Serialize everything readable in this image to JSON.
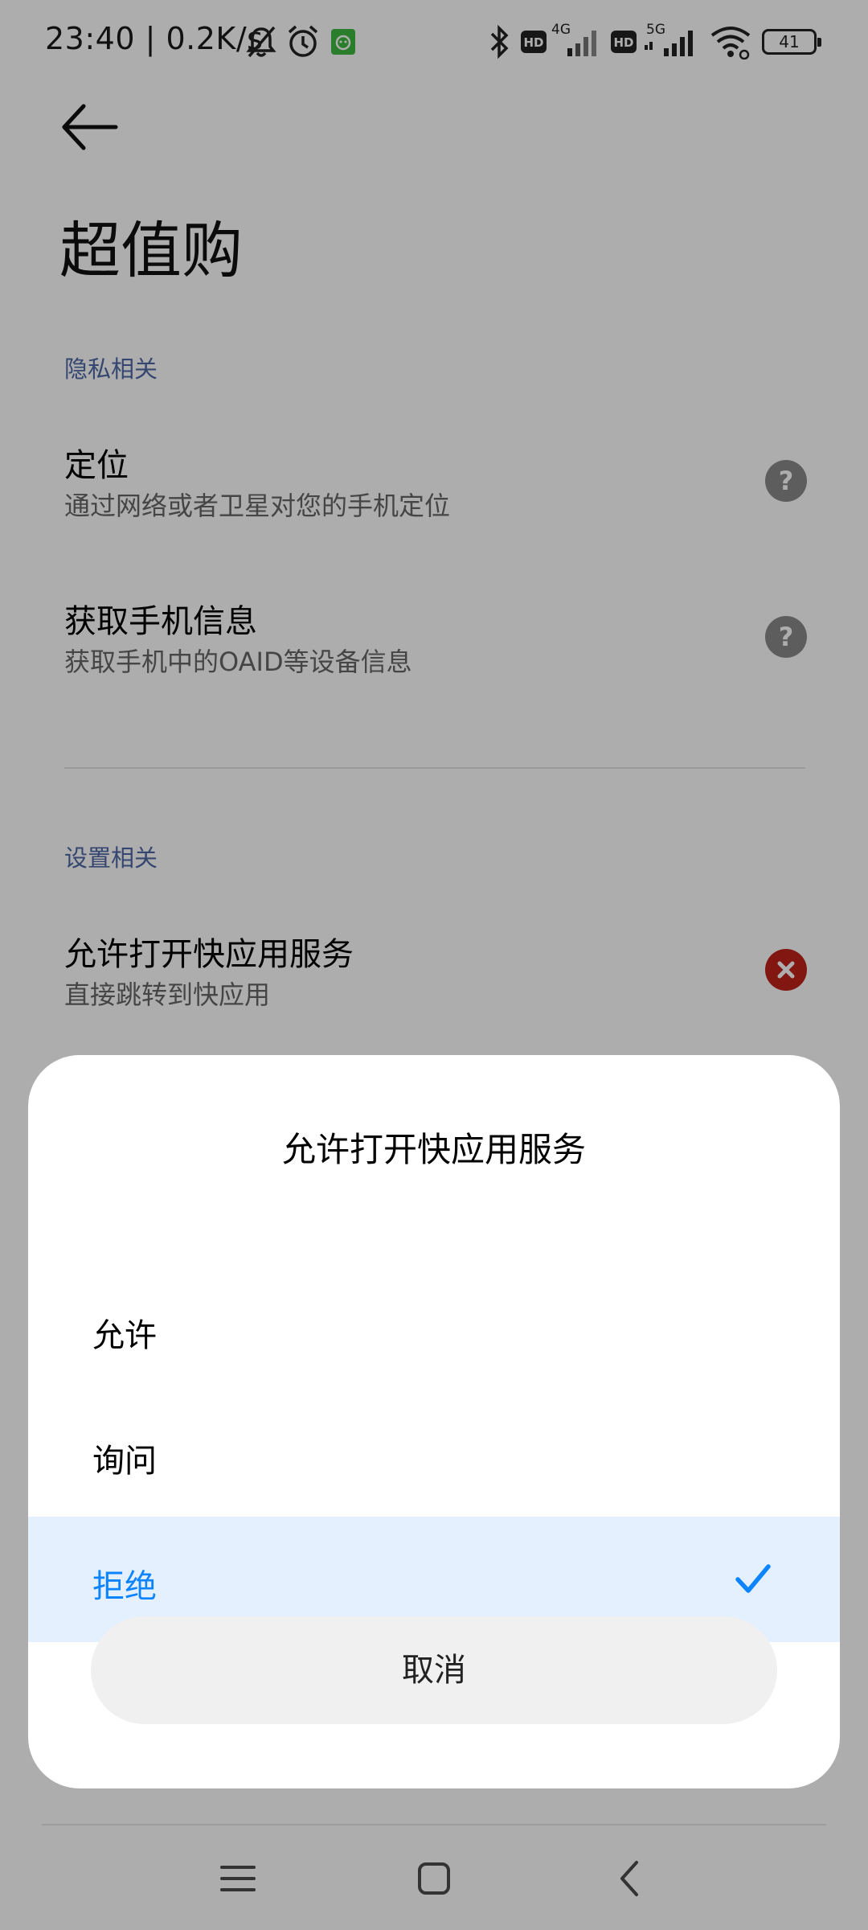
{
  "status_bar": {
    "time_speed": "23:40 | 0.2K/s",
    "battery": "41",
    "network_1": "4G",
    "network_2": "5G",
    "hd_badge": "HD"
  },
  "page": {
    "title": "超值购"
  },
  "sections": {
    "privacy_header": "隐私相关",
    "settings_header": "设置相关"
  },
  "rows": [
    {
      "title": "定位",
      "desc": "通过网络或者卫星对您的手机定位",
      "status": "help-icon"
    },
    {
      "title": "获取手机信息",
      "desc": "获取手机中的OAID等设备信息",
      "status": "help-icon"
    },
    {
      "title": "允许打开快应用服务",
      "desc": "直接跳转到快应用",
      "status": "denied-icon"
    }
  ],
  "dialog": {
    "title": "允许打开快应用服务",
    "options": [
      {
        "label": "允许",
        "selected": false
      },
      {
        "label": "询问",
        "selected": false
      },
      {
        "label": "拒绝",
        "selected": true
      }
    ],
    "cancel_label": "取消"
  },
  "colors": {
    "accent": "#0d84ff",
    "selected_bg": "#e4f0fd",
    "denied": "#c0221a",
    "section_header": "#4e68a5"
  }
}
